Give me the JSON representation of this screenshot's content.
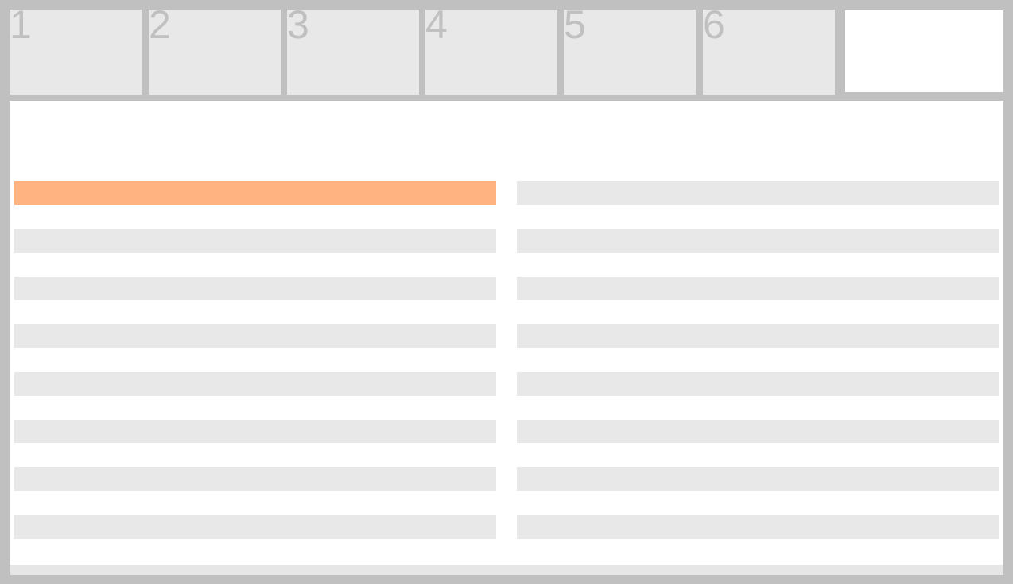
{
  "tabs": [
    {
      "label": "1"
    },
    {
      "label": "2"
    },
    {
      "label": "3"
    },
    {
      "label": "4"
    },
    {
      "label": "5"
    },
    {
      "label": "6"
    }
  ],
  "colors": {
    "frame": "#c0c0c0",
    "tile": "#e8e8e8",
    "panel": "#ffffff",
    "selected_bar": "#ffb380"
  },
  "selected": {
    "column": "left",
    "row_index": 0
  }
}
